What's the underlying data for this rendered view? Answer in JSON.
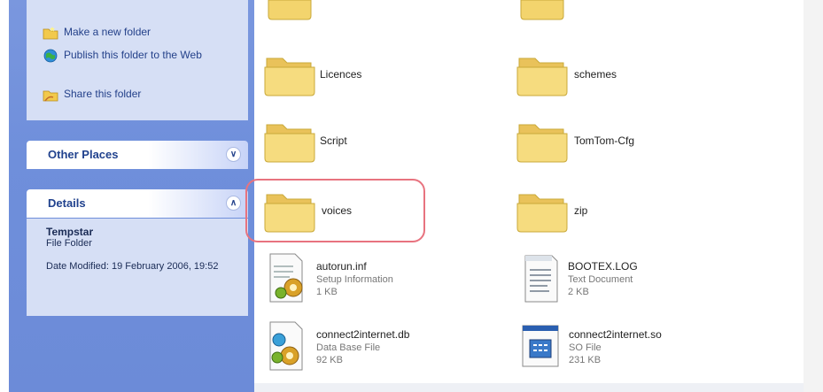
{
  "tasks": {
    "items": [
      {
        "label": "Make a new folder",
        "icon": "new-folder-icon"
      },
      {
        "label": "Publish this folder to the Web",
        "icon": "publish-web-icon"
      },
      {
        "label": "Share this folder",
        "icon": "share-folder-icon"
      }
    ]
  },
  "other_places": {
    "title": "Other Places",
    "chevron": "expand-icon"
  },
  "details": {
    "title": "Details",
    "chevron": "collapse-icon",
    "name": "Tempstar",
    "type": "File Folder",
    "date": "Date Modified: 19 February 2006, 19:52"
  },
  "files": [
    {
      "name": "",
      "type": "folder"
    },
    {
      "name": "",
      "type": "folder"
    },
    {
      "name": "Licences",
      "type": "folder"
    },
    {
      "name": "schemes",
      "type": "folder"
    },
    {
      "name": "Script",
      "type": "folder"
    },
    {
      "name": "TomTom-Cfg",
      "type": "folder"
    },
    {
      "name": "voices",
      "type": "folder",
      "highlighted": true
    },
    {
      "name": "zip",
      "type": "folder"
    },
    {
      "name": "autorun.inf",
      "type": "file",
      "kind": "Setup Information",
      "size": "1 KB"
    },
    {
      "name": "BOOTEX.LOG",
      "type": "file",
      "kind": "Text Document",
      "size": "2 KB"
    },
    {
      "name": "connect2internet.db",
      "type": "file",
      "kind": "Data Base File",
      "size": "92 KB"
    },
    {
      "name": "connect2internet.so",
      "type": "file",
      "kind": "SO File",
      "size": "231 KB"
    }
  ],
  "colors": {
    "pane": "#6f8fdb",
    "panel": "#d6dff5",
    "highlight": "#e8737f",
    "folder": "#f3d46d"
  }
}
